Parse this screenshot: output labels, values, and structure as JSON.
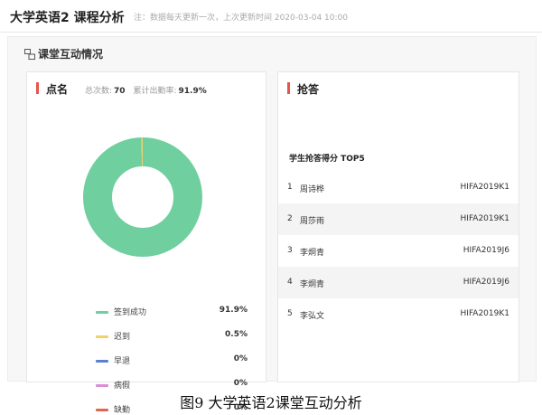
{
  "header": {
    "title": "大学英语2 课程分析",
    "note": "注：数据每天更新一次，上次更新时间 2020-03-04 10:00"
  },
  "section": {
    "title": "课堂互动情况"
  },
  "attendance": {
    "title": "点名",
    "total_label": "总次数:",
    "total_value": "70",
    "rate_label": "累计出勤率:",
    "rate_value": "91.9%"
  },
  "chart_data": {
    "type": "pie",
    "categories": [
      "签到成功",
      "迟到",
      "早退",
      "病假",
      "缺勤"
    ],
    "values": [
      91.9,
      0.5,
      0,
      0,
      0
    ],
    "colors": [
      "#6fcf9e",
      "#f2d06b",
      "#5b7fd8",
      "#d98fd6",
      "#e0674f"
    ],
    "labels": [
      "91.9%",
      "0.5%",
      "0%",
      "0%",
      "0%"
    ]
  },
  "rush": {
    "title": "抢答",
    "subtitle": "学生抢答得分 TOP5",
    "rows": [
      {
        "rank": "1",
        "name": "周诗桦",
        "class": "HIFA2019K1"
      },
      {
        "rank": "2",
        "name": "周莎雨",
        "class": "HIFA2019K1"
      },
      {
        "rank": "3",
        "name": "李炯青",
        "class": "HIFA2019J6"
      },
      {
        "rank": "4",
        "name": "李炯青",
        "class": "HIFA2019J6"
      },
      {
        "rank": "5",
        "name": "李弘文",
        "class": "HIFA2019K1"
      }
    ]
  },
  "caption": "图9  大学英语2课堂互动分析"
}
